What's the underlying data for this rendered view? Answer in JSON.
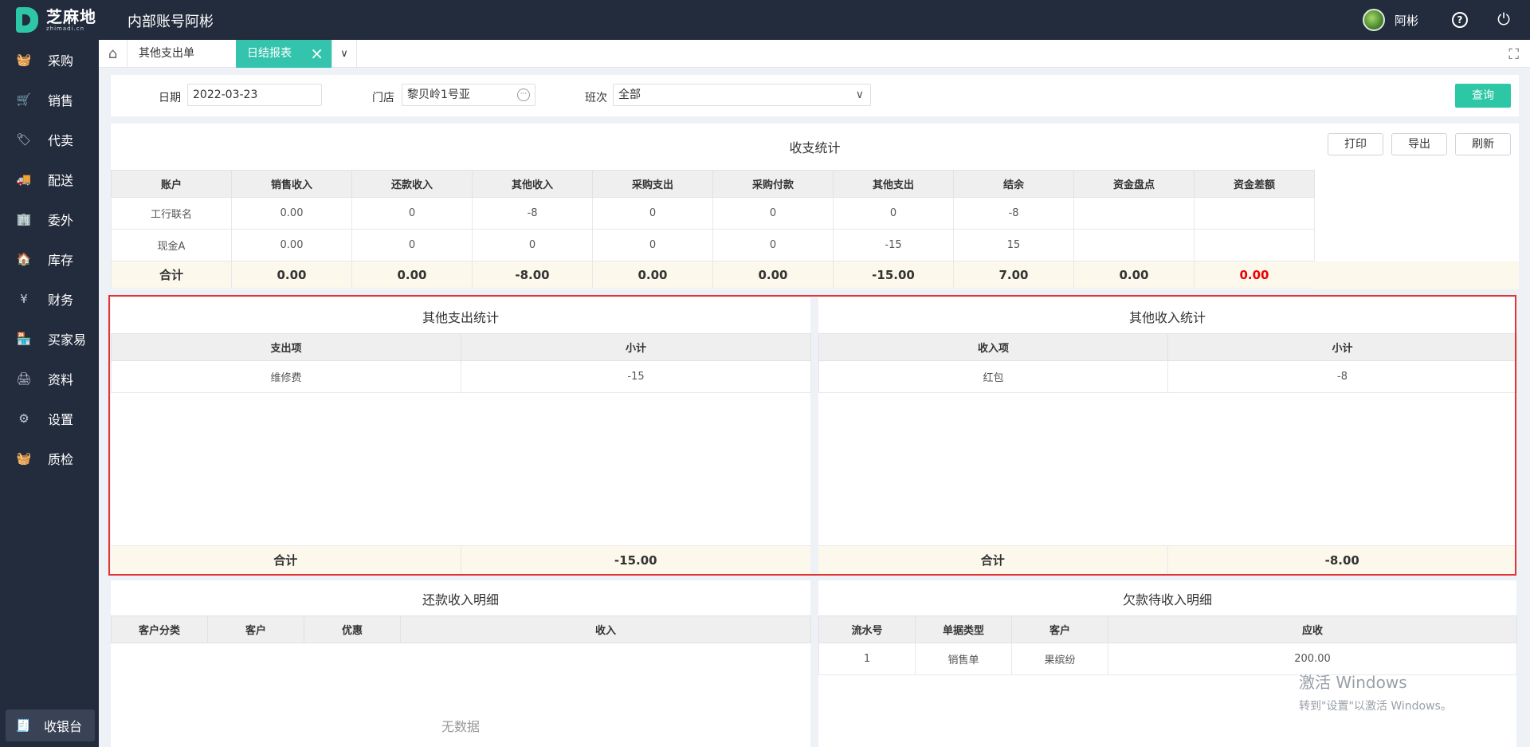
{
  "header": {
    "logo_cn": "芝麻地",
    "logo_en": "zhimadi.cn",
    "app_title": "内部账号阿彬",
    "user_name": "阿彬"
  },
  "sidebar": {
    "items": [
      {
        "label": "采购",
        "icon": "basket-icon"
      },
      {
        "label": "销售",
        "icon": "cart-icon"
      },
      {
        "label": "代卖",
        "icon": "tag-icon"
      },
      {
        "label": "配送",
        "icon": "truck-icon"
      },
      {
        "label": "委外",
        "icon": "building-icon"
      },
      {
        "label": "库存",
        "icon": "warehouse-icon"
      },
      {
        "label": "财务",
        "icon": "yen-icon"
      },
      {
        "label": "买家易",
        "icon": "store-icon"
      },
      {
        "label": "资料",
        "icon": "printer-icon"
      },
      {
        "label": "设置",
        "icon": "gear-icon"
      },
      {
        "label": "质检",
        "icon": "basket-icon"
      }
    ],
    "cashier": "收银台"
  },
  "tabs": {
    "tab1": "其他支出单",
    "tab2": "日结报表"
  },
  "filter": {
    "date_label": "日期",
    "date_value": "2022-03-23",
    "store_label": "门店",
    "store_value": "黎贝岭1号亚",
    "shift_label": "班次",
    "shift_value": "全部",
    "query": "查询"
  },
  "summary": {
    "title": "收支统计",
    "buttons": {
      "print": "打印",
      "export": "导出",
      "refresh": "刷新"
    },
    "headers": [
      "账户",
      "销售收入",
      "还款收入",
      "其他收入",
      "采购支出",
      "采购付款",
      "其他支出",
      "结余",
      "资金盘点",
      "资金差额"
    ],
    "rows": [
      [
        "工行联名",
        "0.00",
        "0",
        "-8",
        "0",
        "0",
        "0",
        "-8",
        "",
        ""
      ],
      [
        "现金A",
        "0.00",
        "0",
        "0",
        "0",
        "0",
        "-15",
        "15",
        "",
        ""
      ]
    ],
    "total": [
      "合计",
      "0.00",
      "0.00",
      "-8.00",
      "0.00",
      "0.00",
      "-15.00",
      "7.00",
      "0.00",
      "0.00"
    ]
  },
  "other_expense": {
    "title": "其他支出统计",
    "headers": [
      "支出项",
      "小计"
    ],
    "rows": [
      [
        "维修费",
        "-15"
      ]
    ],
    "total_label": "合计",
    "total_value": "-15.00"
  },
  "other_income": {
    "title": "其他收入统计",
    "headers": [
      "收入项",
      "小计"
    ],
    "rows": [
      [
        "红包",
        "-8"
      ]
    ],
    "total_label": "合计",
    "total_value": "-8.00"
  },
  "repayment": {
    "title": "还款收入明细",
    "headers": [
      "客户分类",
      "客户",
      "优惠",
      "收入"
    ],
    "empty": "无数据"
  },
  "receivable": {
    "title": "欠款待收入明细",
    "headers": [
      "流水号",
      "单据类型",
      "客户",
      "应收"
    ],
    "rows": [
      [
        "1",
        "销售单",
        "果缤纷",
        "200.00"
      ]
    ]
  },
  "watermark": {
    "line1": "激活 Windows",
    "line2": "转到\"设置\"以激活 Windows。"
  }
}
